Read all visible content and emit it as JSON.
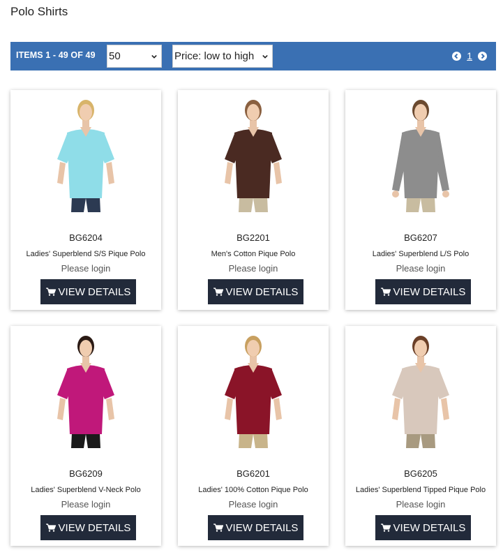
{
  "page": {
    "title": "Polo Shirts"
  },
  "toolbar": {
    "items_count": "ITEMS 1 - 49 OF 49",
    "page_size": "50",
    "sort": "Price: low to high",
    "current_page": "1"
  },
  "colors": {
    "toolbar": "#3a70b3",
    "button": "#222a3a"
  },
  "products": [
    {
      "sku": "BG6204",
      "name": "Ladies' Superblend S/S Pique Polo",
      "price": "Please login",
      "button": "VIEW DETAILS",
      "shirt": "#8fdde8",
      "pants": "#2c3a52",
      "hair": "#d8b46a",
      "sleeve": "short"
    },
    {
      "sku": "BG2201",
      "name": "Men's Cotton Pique Polo",
      "price": "Please login",
      "button": "VIEW DETAILS",
      "shirt": "#4a2a22",
      "pants": "#c8bca0",
      "hair": "#8a6040",
      "sleeve": "short"
    },
    {
      "sku": "BG6207",
      "name": "Ladies' Superblend L/S Polo",
      "price": "Please login",
      "button": "VIEW DETAILS",
      "shirt": "#8d8d8d",
      "pants": "#c8bca0",
      "hair": "#6b4a30",
      "sleeve": "long"
    },
    {
      "sku": "BG6209",
      "name": "Ladies' Superblend V-Neck Polo",
      "price": "Please login",
      "button": "VIEW DETAILS",
      "shirt": "#c0187a",
      "pants": "#1a1a1a",
      "hair": "#2a1a14",
      "sleeve": "short"
    },
    {
      "sku": "BG6201",
      "name": "Ladies' 100% Cotton Pique Polo",
      "price": "Please login",
      "button": "VIEW DETAILS",
      "shirt": "#8a1428",
      "pants": "#c8b48a",
      "hair": "#c8a060",
      "sleeve": "short"
    },
    {
      "sku": "BG6205",
      "name": "Ladies' Superblend Tipped Pique Polo",
      "price": "Please login",
      "button": "VIEW DETAILS",
      "shirt": "#d8c8bc",
      "pants": "#a89a80",
      "hair": "#6b4028",
      "sleeve": "short"
    }
  ]
}
